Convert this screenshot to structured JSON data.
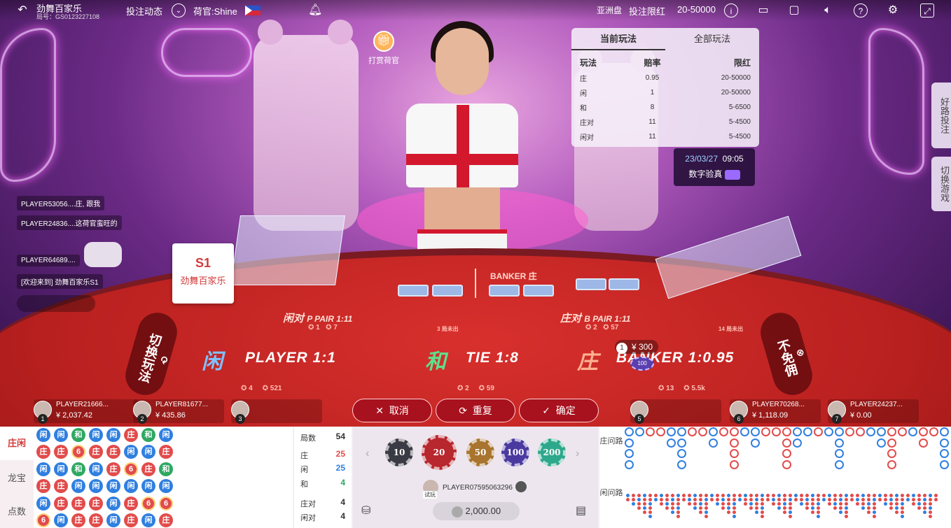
{
  "topbar": {
    "game_title": "劲舞百家乐",
    "round_no": "局号：GS0123227108",
    "bet_feed_label": "投注动态",
    "dealer_label": "荷官:Shine",
    "region_label": "亚洲盘",
    "limit_label": "投注限红",
    "limit_value": "20-50000"
  },
  "tip_dealer": {
    "label": "打赏荷官"
  },
  "limits": {
    "tabs": [
      "当前玩法",
      "全部玩法"
    ],
    "headers": {
      "play": "玩法",
      "odds": "赔率",
      "limit": "限红"
    },
    "rows": [
      {
        "play": "庄",
        "odds": "0.95",
        "limit": "20-50000"
      },
      {
        "play": "闲",
        "odds": "1",
        "limit": "20-50000"
      },
      {
        "play": "和",
        "odds": "8",
        "limit": "5-6500"
      },
      {
        "play": "庄对",
        "odds": "11",
        "limit": "5-4500"
      },
      {
        "play": "闲对",
        "odds": "11",
        "limit": "5-4500"
      }
    ]
  },
  "verify": {
    "date": "23/03/27",
    "time": "09:05",
    "label": "数字验真"
  },
  "right_tabs": {
    "good_road": "好路投注",
    "switch_game": "切换游戏"
  },
  "chat": [
    "PLAYER53056....庄, 跟我",
    "PLAYER24836....这荷官蛮旺的",
    "PLAYER64689....",
    "[欢迎来到] 劲舞百家乐S1"
  ],
  "plaque": {
    "code": "S1",
    "name": "劲舞百家乐"
  },
  "table": {
    "player_pair": "闲对",
    "player_pair_en": "P PAIR 1:11",
    "banker_pair": "庄对",
    "banker_pair_en": "B PAIR 1:11",
    "player_cn": "闲",
    "player_en": "PLAYER 1:1",
    "tie_cn": "和",
    "tie_en": "TIE 1:8",
    "banker_cn": "庄",
    "banker_en": "BANKER 1:0.95",
    "banker_label": "BANKER 庄",
    "switch_play": "切换玩法",
    "no_commission": "不免佣",
    "ppair_stats": "1",
    "ppair_stats2": "7",
    "bpair_stats": "2",
    "bpair_stats2": "57",
    "player_stats": "4",
    "player_stats2": "521",
    "tie_stats": "2",
    "tie_stats2": "59",
    "banker_stats": "13",
    "banker_stats2": "5.5k",
    "ppair_missed": "3 局未出",
    "bpair_missed": "14 局未出",
    "bet_seat": "1",
    "bet_amount": "¥ 300",
    "chip_on_table": "100"
  },
  "seats": [
    {
      "no": "1",
      "name": "PLAYER21666...",
      "balance": "¥ 2,037.42"
    },
    {
      "no": "2",
      "name": "PLAYER81677...",
      "balance": "¥ 435.86"
    },
    {
      "no": "3",
      "name": "",
      "balance": ""
    },
    {
      "no": "5",
      "name": "",
      "balance": ""
    },
    {
      "no": "6",
      "name": "PLAYER70268...",
      "balance": "¥ 1,118.09"
    },
    {
      "no": "7",
      "name": "PLAYER24237...",
      "balance": "¥ 0.00"
    }
  ],
  "actions": {
    "cancel": "取消",
    "repeat": "重复",
    "confirm": "确定"
  },
  "road_tabs": [
    "庄闲",
    "龙宝",
    "点数"
  ],
  "bead_road": [
    [
      "闲",
      "庄",
      "闲",
      "庄",
      "闲",
      "6"
    ],
    [
      "闲",
      "庄",
      "闲",
      "庄",
      "庄",
      "闲"
    ],
    [
      "和",
      "6",
      "和",
      "闲",
      "庄",
      "庄"
    ],
    [
      "闲",
      "庄",
      "闲",
      "闲",
      "庄",
      "庄"
    ],
    [
      "闲",
      "庄",
      "庄",
      "闲",
      "闲",
      "闲"
    ],
    [
      "庄",
      "闲",
      "6",
      "闲",
      "庄",
      "庄"
    ],
    [
      "和",
      "闲",
      "庄",
      "闲",
      "6",
      "闲"
    ],
    [
      "闲",
      "庄",
      "和",
      "闲",
      "6",
      "庄"
    ]
  ],
  "stats": [
    {
      "label": "局数",
      "value": "54"
    },
    {
      "label": "庄",
      "value": "25"
    },
    {
      "label": "闲",
      "value": "25"
    },
    {
      "label": "和",
      "value": "4"
    },
    {
      "label": "庄对",
      "value": "4"
    },
    {
      "label": "闲对",
      "value": "4"
    }
  ],
  "chips": [
    "10",
    "20",
    "50",
    "100",
    "200"
  ],
  "player": {
    "id": "PLAYER07595063296",
    "badge": "试玩",
    "balance": "2,000.00"
  },
  "big_road_labels": {
    "banker_ask": "庄问路",
    "player_ask": "闲问路"
  },
  "colors": {
    "banker": "#e24b4b",
    "player": "#2f7fe0",
    "tie": "#2ea862",
    "accent": "#a8111e"
  }
}
